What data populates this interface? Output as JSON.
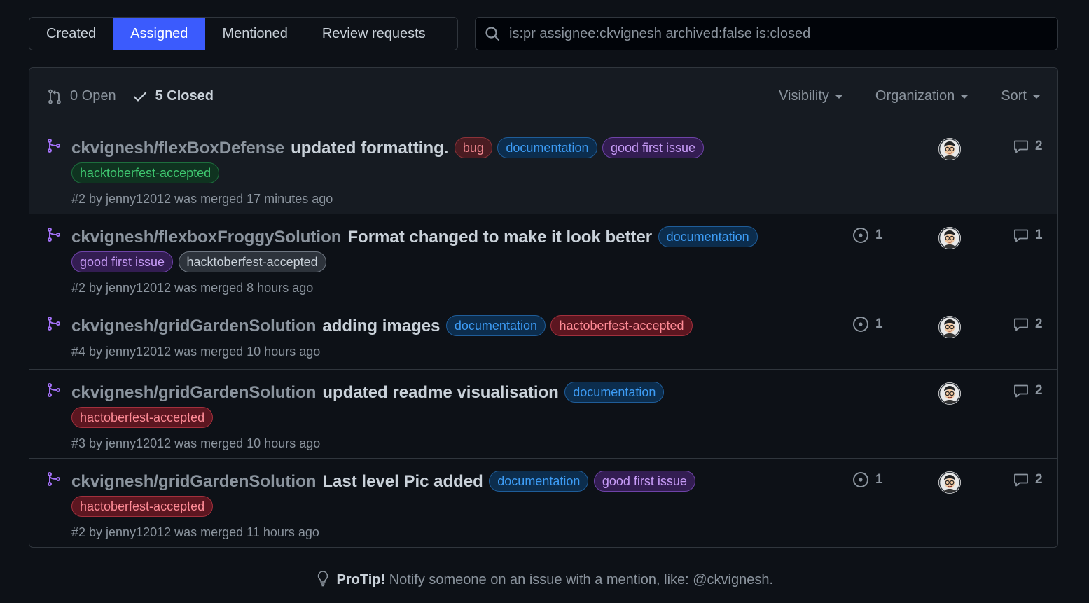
{
  "tabs": [
    {
      "label": "Created",
      "active": false
    },
    {
      "label": "Assigned",
      "active": true
    },
    {
      "label": "Mentioned",
      "active": false
    },
    {
      "label": "Review requests",
      "active": false
    }
  ],
  "search": {
    "value": "is:pr assignee:ckvignesh archived:false is:closed",
    "icon": "search-icon"
  },
  "states": {
    "open": "0 Open",
    "closed": "5 Closed"
  },
  "filters": {
    "visibility": "Visibility",
    "organization": "Organization",
    "sort": "Sort"
  },
  "colors": {
    "accent": "#3b5bfd",
    "merged": "#a371f7",
    "background": "#0d1117"
  },
  "label_styles": {
    "bug": {
      "fg": "#f0878f",
      "bg": "#4a1c22",
      "border": "#8c3339"
    },
    "documentation": {
      "fg": "#3d9cf5",
      "bg": "#0c2d4d",
      "border": "#1f5d99"
    },
    "good first issue": {
      "fg": "#c79bf7",
      "bg": "#331d52",
      "border": "#6e43a8"
    },
    "hacktoberfest-accepted-green": {
      "fg": "#3fc770",
      "bg": "#0f3320",
      "border": "#1d6e3d"
    },
    "hacktoberfest-accepted-gray": {
      "fg": "#c9d1d9",
      "bg": "#2d333b",
      "border": "#6e7681"
    },
    "hactoberfest-accepted": {
      "fg": "#ff8b96",
      "bg": "#5c1620",
      "border": "#a3303d"
    }
  },
  "pull_requests": [
    {
      "repo": "ckvignesh/flexBoxDefense",
      "title": "updated formatting.",
      "labels": [
        {
          "text": "bug",
          "style": "bug"
        },
        {
          "text": "documentation",
          "style": "documentation"
        },
        {
          "text": "good first issue",
          "style": "good first issue"
        },
        {
          "text": "hacktoberfest-accepted",
          "style": "hacktoberfest-accepted-green"
        }
      ],
      "meta": "#2 by jenny12012 was merged 17 minutes ago",
      "linked_issues": null,
      "comments": "2",
      "highlighted": true
    },
    {
      "repo": "ckvignesh/flexboxFroggySolution",
      "title": "Format changed to make it look better",
      "labels": [
        {
          "text": "documentation",
          "style": "documentation"
        },
        {
          "text": "good first issue",
          "style": "good first issue"
        },
        {
          "text": "hacktoberfest-accepted",
          "style": "hacktoberfest-accepted-gray"
        }
      ],
      "meta": "#2 by jenny12012 was merged 8 hours ago",
      "linked_issues": "1",
      "comments": "1",
      "highlighted": false
    },
    {
      "repo": "ckvignesh/gridGardenSolution",
      "title": "adding images",
      "labels": [
        {
          "text": "documentation",
          "style": "documentation"
        },
        {
          "text": "hactoberfest-accepted",
          "style": "hactoberfest-accepted"
        }
      ],
      "meta": "#4 by jenny12012 was merged 10 hours ago",
      "linked_issues": "1",
      "comments": "2",
      "highlighted": false
    },
    {
      "repo": "ckvignesh/gridGardenSolution",
      "title": "updated readme visualisation",
      "labels": [
        {
          "text": "documentation",
          "style": "documentation"
        },
        {
          "text": "hactoberfest-accepted",
          "style": "hactoberfest-accepted"
        }
      ],
      "meta": "#3 by jenny12012 was merged 10 hours ago",
      "linked_issues": null,
      "comments": "2",
      "highlighted": false
    },
    {
      "repo": "ckvignesh/gridGardenSolution",
      "title": "Last level Pic added",
      "labels": [
        {
          "text": "documentation",
          "style": "documentation"
        },
        {
          "text": "good first issue",
          "style": "good first issue"
        },
        {
          "text": "hactoberfest-accepted",
          "style": "hactoberfest-accepted"
        }
      ],
      "meta": "#2 by jenny12012 was merged 11 hours ago",
      "linked_issues": "1",
      "comments": "2",
      "highlighted": false
    }
  ],
  "protip": {
    "bold": "ProTip!",
    "text": "Notify someone on an issue with a mention, like: @ckvignesh."
  }
}
